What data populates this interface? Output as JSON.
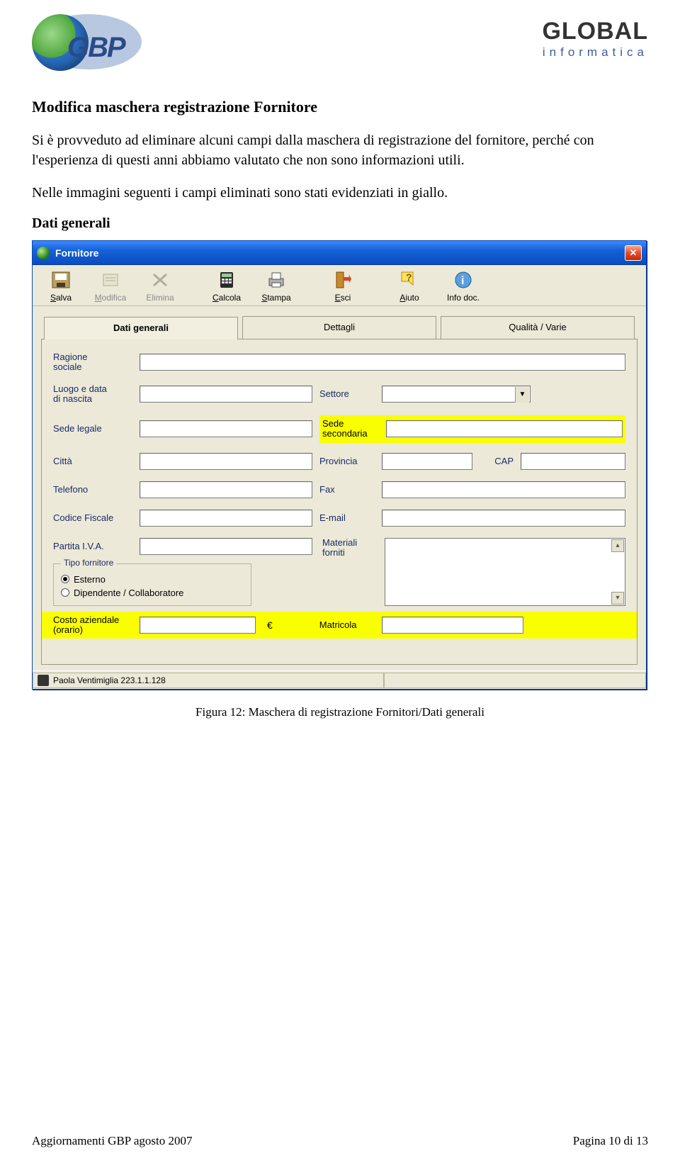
{
  "header": {
    "logo_left_text": "GBP",
    "logo_right_line1": "GLOBAL",
    "logo_right_line2": "informatica"
  },
  "document": {
    "heading": "Modifica maschera registrazione Fornitore",
    "para1": "Si è provveduto ad eliminare alcuni campi dalla maschera di registrazione del fornitore, perché con l'esperienza di questi anni abbiamo valutato che non sono informazioni utili.",
    "para2": "Nelle immagini seguenti i campi eliminati sono stati evidenziati in giallo.",
    "sub_heading": "Dati generali",
    "caption": "Figura 12: Maschera di registrazione Fornitori/Dati generali"
  },
  "dialog": {
    "title": "Fornitore",
    "toolbar": {
      "salva": "Salva",
      "modifica": "Modifica",
      "elimina": "Elimina",
      "calcola": "Calcola",
      "stampa": "Stampa",
      "esci": "Esci",
      "aiuto": "Aiuto",
      "info": "Info doc."
    },
    "tabs": {
      "dati_generali": "Dati generali",
      "dettagli": "Dettagli",
      "qualita": "Qualità / Varie"
    },
    "labels": {
      "ragione_sociale": "Ragione\nsociale",
      "luogo_data_nascita": "Luogo e data\ndi nascita",
      "settore": "Settore",
      "sede_legale": "Sede legale",
      "sede_secondaria": "Sede\nsecondaria",
      "citta": "Città",
      "provincia": "Provincia",
      "cap": "CAP",
      "telefono": "Telefono",
      "fax": "Fax",
      "codice_fiscale": "Codice Fiscale",
      "email": "E-mail",
      "partita_iva": "Partita I.V.A.",
      "materiali_forniti": "Materiali\nforniti",
      "tipo_fornitore": "Tipo fornitore",
      "esterno": "Esterno",
      "dipendente": "Dipendente / Collaboratore",
      "costo_aziendale": "Costo aziendale\n(orario)",
      "matricola": "Matricola",
      "euro": "€"
    },
    "status": "Paola Ventimiglia 223.1.1.128"
  },
  "footer": {
    "left": "Aggiornamenti GBP agosto 2007",
    "right": "Pagina 10 di 13"
  }
}
